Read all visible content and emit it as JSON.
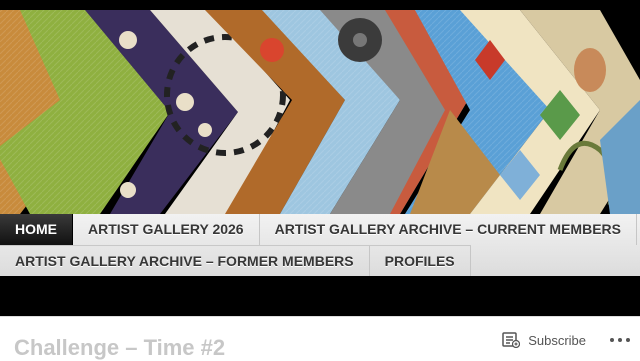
{
  "banner": {
    "alt": "quilt art banner"
  },
  "nav": {
    "row1": [
      {
        "label": "HOME",
        "active": true
      },
      {
        "label": "ARTIST GALLERY 2026"
      },
      {
        "label": "ARTIST GALLERY ARCHIVE – CURRENT MEMBERS"
      }
    ],
    "row2": [
      {
        "label": "ARTIST GALLERY ARCHIVE – FORMER MEMBERS"
      },
      {
        "label": "PROFILES"
      }
    ]
  },
  "post": {
    "title": "Challenge – Time #2"
  },
  "actionbar": {
    "subscribe_label": "Subscribe",
    "subscribe_icon": "reader-subscribe-icon",
    "more_icon": "ellipsis-icon"
  }
}
